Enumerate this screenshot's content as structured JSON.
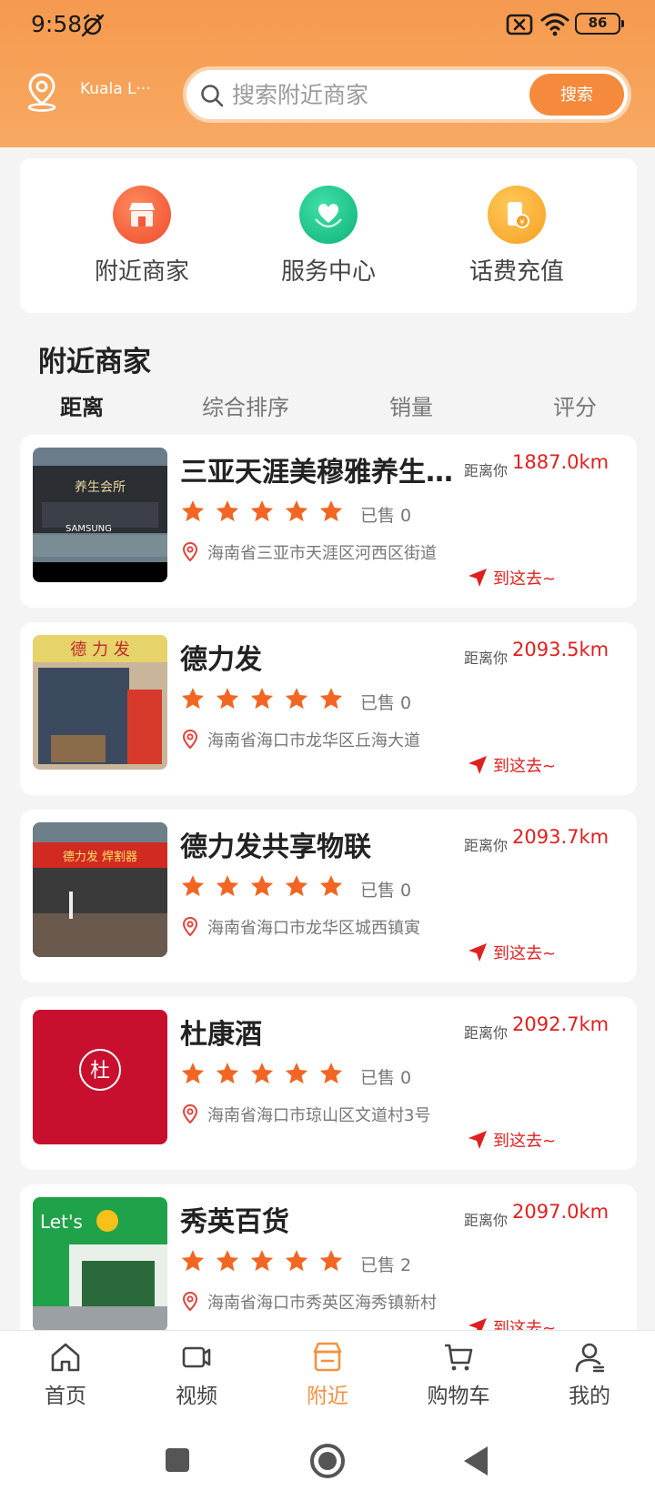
{
  "status_bar": {
    "time": "9:58",
    "battery": "86"
  },
  "header": {
    "location": "Kuala L···",
    "search_placeholder": "搜索附近商家",
    "search_button": "搜索"
  },
  "quick_menu": [
    {
      "label": "附近商家",
      "color": "#f45a3a"
    },
    {
      "label": "服务中心",
      "color": "#14c48a"
    },
    {
      "label": "话费充值",
      "color": "#fbab2a"
    }
  ],
  "section": {
    "title": "附近商家",
    "sort_tabs": [
      "距离",
      "综合排序",
      "销量",
      "评分"
    ],
    "active_tab": "距离"
  },
  "shops": [
    {
      "name": "三亚天涯美穆雅养生会所",
      "distance_label": "距离你",
      "distance": "1887.0km",
      "sold": "已售 0",
      "address": "海南省三亚市天涯区河西区街道",
      "go": "到这去~"
    },
    {
      "name": "德力发",
      "distance_label": "距离你",
      "distance": "2093.5km",
      "sold": "已售 0",
      "address": "海南省海口市龙华区丘海大道",
      "go": "到这去~"
    },
    {
      "name": "德力发共享物联",
      "distance_label": "距离你",
      "distance": "2093.7km",
      "sold": "已售 0",
      "address": "海南省海口市龙华区城西镇寅",
      "go": "到这去~"
    },
    {
      "name": "杜康酒",
      "distance_label": "距离你",
      "distance": "2092.7km",
      "sold": "已售 0",
      "address": "海南省海口市琼山区文道村3号",
      "go": "到这去~"
    },
    {
      "name": "秀英百货",
      "distance_label": "距离你",
      "distance": "2097.0km",
      "sold": "已售 2",
      "address": "海南省海口市秀英区海秀镇新村",
      "go": "到这去~"
    }
  ],
  "bottom_nav": [
    {
      "label": "首页"
    },
    {
      "label": "视频"
    },
    {
      "label": "附近"
    },
    {
      "label": "购物车"
    },
    {
      "label": "我的"
    }
  ],
  "colors": {
    "accent": "#f5913f",
    "distance": "#e02020",
    "star": "#f26522"
  }
}
